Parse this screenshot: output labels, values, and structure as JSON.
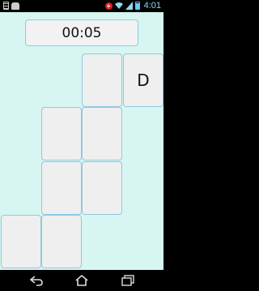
{
  "status_bar": {
    "time": "4:01",
    "icons": [
      "sim-icon",
      "cat-icon",
      "alert-icon",
      "wifi-icon",
      "signal-icon",
      "battery-icon"
    ]
  },
  "game": {
    "timer": "00:05",
    "background_color": "#d7f5f1",
    "cards": [
      {
        "label": ""
      },
      {
        "label": "D"
      },
      {
        "label": ""
      },
      {
        "label": ""
      },
      {
        "label": ""
      },
      {
        "label": ""
      },
      {
        "label": ""
      },
      {
        "label": ""
      }
    ]
  },
  "nav_bar": {
    "buttons": [
      "back-icon",
      "home-icon",
      "recents-icon"
    ]
  }
}
